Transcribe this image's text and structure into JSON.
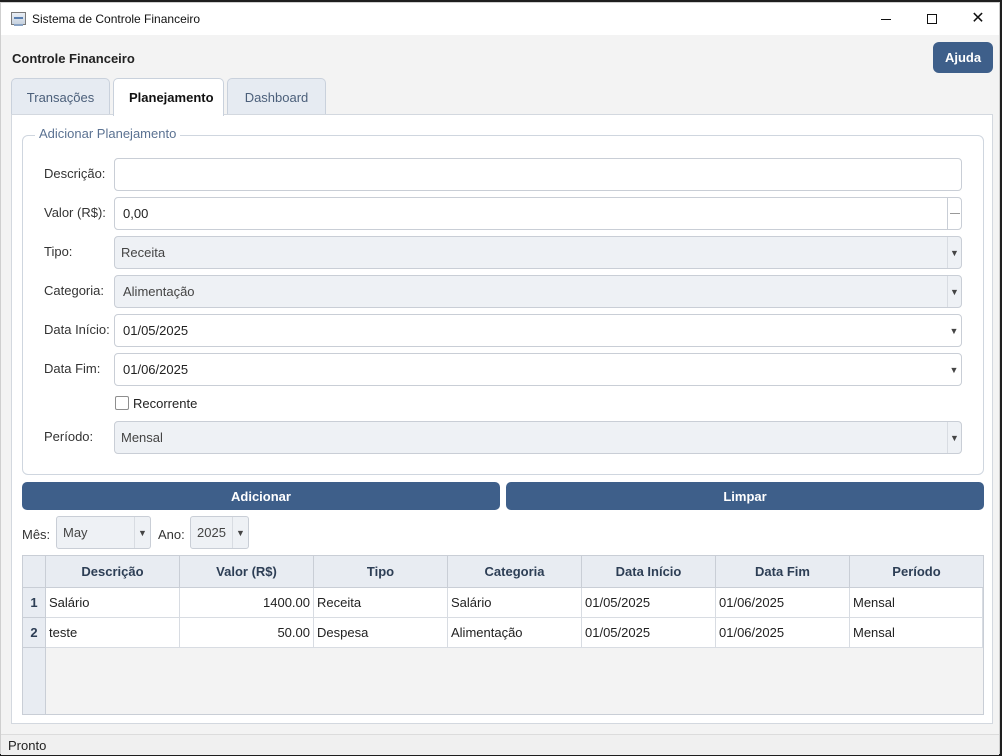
{
  "window": {
    "title": "Sistema de Controle Financeiro",
    "minimize_glyph": "",
    "close_glyph": "✕"
  },
  "header": {
    "title": "Controle Financeiro",
    "help_label": "Ajuda"
  },
  "tabs": [
    {
      "label": "Transações",
      "active": false
    },
    {
      "label": "Planejamento",
      "active": true
    },
    {
      "label": "Dashboard",
      "active": false
    }
  ],
  "form": {
    "group_title": "Adicionar Planejamento",
    "description": {
      "label": "Descrição:",
      "value": ""
    },
    "amount": {
      "label": "Valor (R$):",
      "value": "0,00"
    },
    "type": {
      "label": "Tipo:",
      "value": "Receita"
    },
    "category": {
      "label": "Categoria:",
      "value": "Alimentação"
    },
    "start_date": {
      "label": "Data Início:",
      "value": "01/05/2025"
    },
    "end_date": {
      "label": "Data Fim:",
      "value": "01/06/2025"
    },
    "recurring": {
      "label": "Recorrente",
      "checked": false
    },
    "period": {
      "label": "Período:",
      "value": "Mensal"
    }
  },
  "actions": {
    "add_label": "Adicionar",
    "clear_label": "Limpar"
  },
  "filter": {
    "month_label": "Mês:",
    "month_value": "May",
    "year_label": "Ano:",
    "year_value": "2025"
  },
  "table": {
    "columns": [
      "Descrição",
      "Valor (R$)",
      "Tipo",
      "Categoria",
      "Data Início",
      "Data Fim",
      "Período"
    ],
    "rows": [
      {
        "num": "1",
        "cells": [
          "Salário",
          "1400.00",
          "Receita",
          "Salário",
          "01/05/2025",
          "01/06/2025",
          "Mensal"
        ]
      },
      {
        "num": "2",
        "cells": [
          "teste",
          "50.00",
          "Despesa",
          "Alimentação",
          "01/05/2025",
          "01/06/2025",
          "Mensal"
        ]
      }
    ]
  },
  "status": {
    "text": "Pronto"
  },
  "icons": {
    "app": "app-icon",
    "dropdown": "chevron-down-icon"
  },
  "colors": {
    "accent": "#3e5f8a",
    "header_bg": "#e8ecf2"
  }
}
